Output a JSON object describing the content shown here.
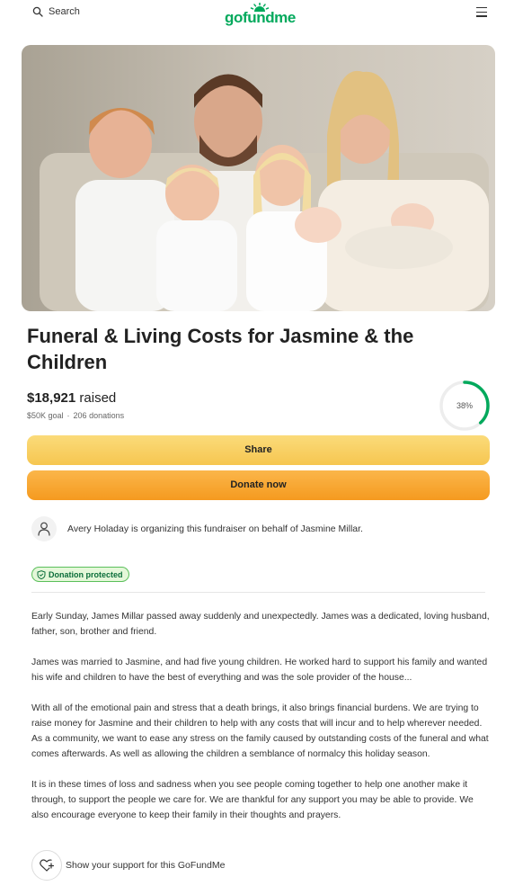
{
  "header": {
    "search_label": "Search",
    "logo_text": "gofundme",
    "brand_color": "#02a95c"
  },
  "hero": {
    "image_desc_icon": "family-photo"
  },
  "campaign": {
    "title": "Funeral & Living Costs for Jasmine & the Children",
    "raised_amount": "$18,921",
    "raised_label": "raised",
    "goal": "$50K goal",
    "donations": "206 donations",
    "progress_percent_label": "38%",
    "progress_fraction": 0.38
  },
  "actions": {
    "share_label": "Share",
    "donate_label": "Donate now"
  },
  "organizer": {
    "text": "Avery Holaday is organizing this fundraiser on behalf of Jasmine Millar."
  },
  "badge": {
    "protected_label": "Donation protected"
  },
  "story": {
    "paragraphs": [
      "Early Sunday, James Millar passed away suddenly and unexpectedly. James was a dedicated, loving husband, father, son, brother and friend.",
      "James was married to Jasmine, and had five young children. He worked hard to support his family and wanted his wife and children to have the best of everything and was the sole provider of the house...",
      "With all of the emotional pain and stress that a death brings, it also brings financial burdens. We are trying to raise money for Jasmine and their children to help with any costs that will incur and to help wherever needed. As a community, we want to ease any stress on the family caused by outstanding costs of the funeral and what comes afterwards. As well as allowing the children a semblance of normalcy this holiday season.",
      "It is in these times of loss and sadness when you see people coming together to help one another make it through, to support the people we care for. We are thankful for any support you may be able to provide. We also encourage everyone to keep their family in their thoughts and prayers."
    ]
  },
  "support": {
    "label": "Show your support for this GoFundMe"
  }
}
